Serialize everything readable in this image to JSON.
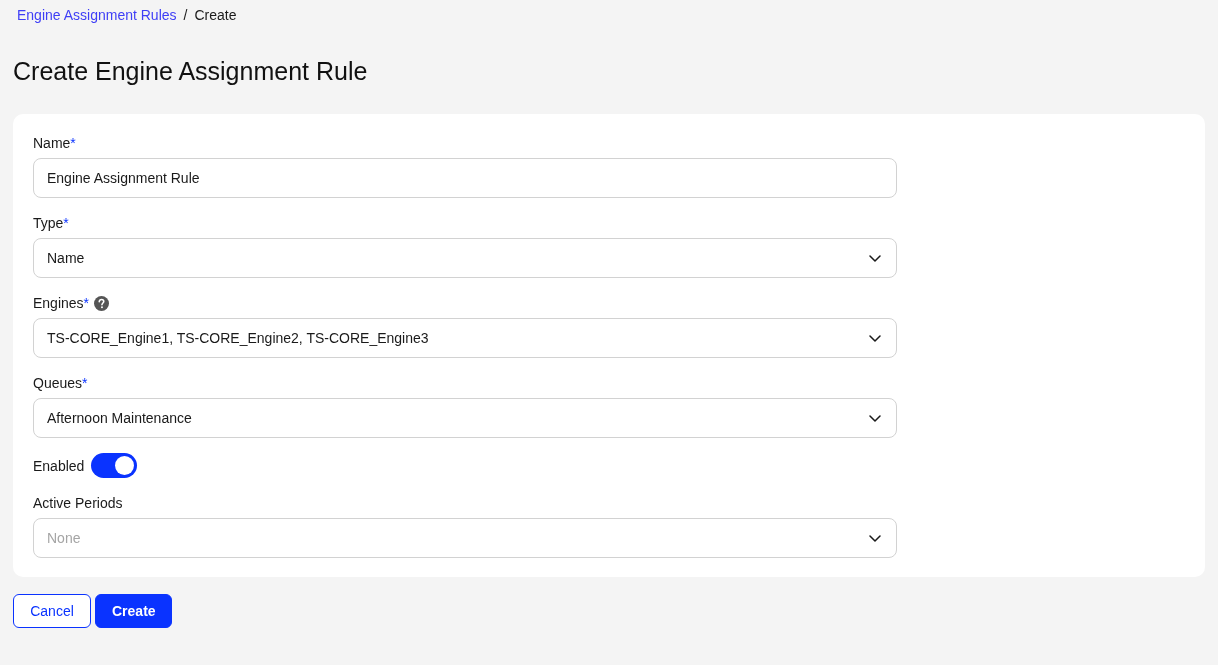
{
  "breadcrumb": {
    "items": [
      {
        "label": "Engine Assignment Rules",
        "kind": "link"
      },
      {
        "label": "Create",
        "kind": "current"
      }
    ],
    "separator": "/"
  },
  "title": "Create Engine Assignment Rule",
  "form": {
    "required_mark": "*",
    "fields": [
      {
        "kind": "text",
        "label": "Name",
        "required": true,
        "value": "Engine Assignment Rule"
      },
      {
        "kind": "select",
        "label": "Type",
        "required": true,
        "value": "Name"
      },
      {
        "kind": "select",
        "label": "Engines",
        "required": true,
        "help": true,
        "value": "TS-CORE_Engine1, TS-CORE_Engine2, TS-CORE_Engine3"
      },
      {
        "kind": "select",
        "label": "Queues",
        "required": true,
        "value": "Afternoon Maintenance"
      },
      {
        "kind": "toggle",
        "label": "Enabled",
        "required": false,
        "on": true
      },
      {
        "kind": "select",
        "label": "Active Periods",
        "required": false,
        "placeholder": "None"
      }
    ]
  },
  "buttons": [
    {
      "label": "Cancel",
      "kind": "secondary"
    },
    {
      "label": "Create",
      "kind": "primary"
    }
  ]
}
